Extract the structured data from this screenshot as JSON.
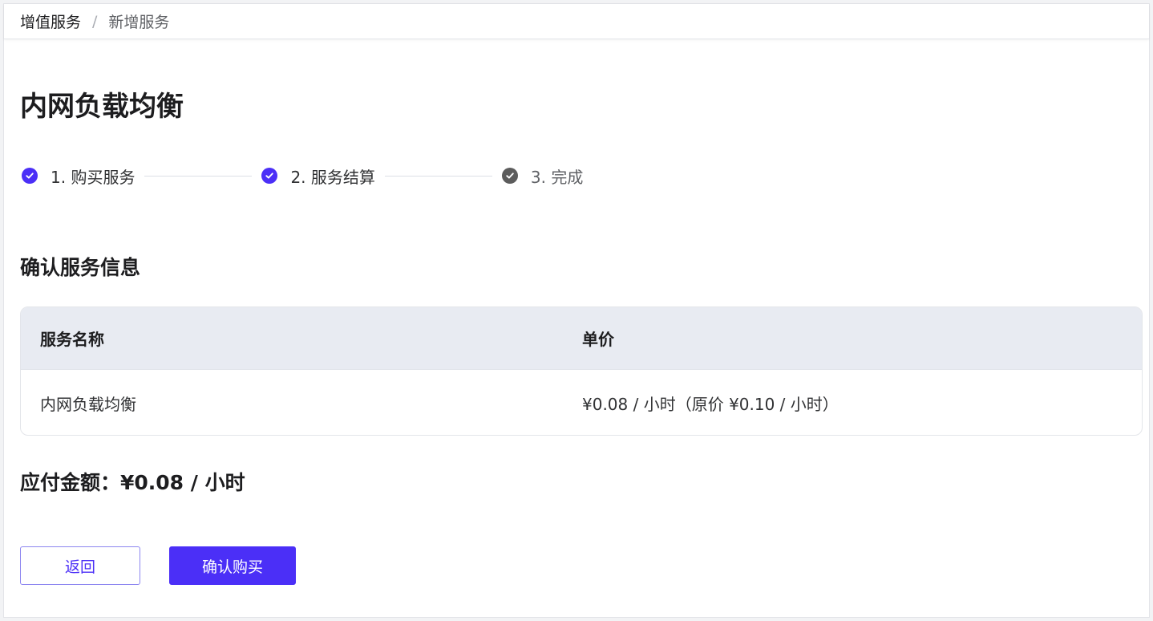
{
  "breadcrumb": {
    "root": "增值服务",
    "separator": "/",
    "current": "新增服务"
  },
  "page_title": "内网负载均衡",
  "steps": [
    {
      "label": "1. 购买服务",
      "status": "done"
    },
    {
      "label": "2. 服务结算",
      "status": "done"
    },
    {
      "label": "3. 完成",
      "status": "pending"
    }
  ],
  "section_title": "确认服务信息",
  "table": {
    "headers": [
      "服务名称",
      "单价"
    ],
    "rows": [
      [
        "内网负载均衡",
        "¥0.08 / 小时（原价 ¥0.10 / 小时）"
      ]
    ]
  },
  "total": "应付金额：¥0.08 / 小时",
  "buttons": {
    "back": "返回",
    "confirm": "确认购买"
  },
  "colors": {
    "accent": "#4b2ff7",
    "pending_step": "#5c5c5c",
    "table_header_bg": "#e8ebf2"
  },
  "icons": {
    "step_done": "check-circle-icon",
    "step_pending": "check-circle-icon"
  }
}
